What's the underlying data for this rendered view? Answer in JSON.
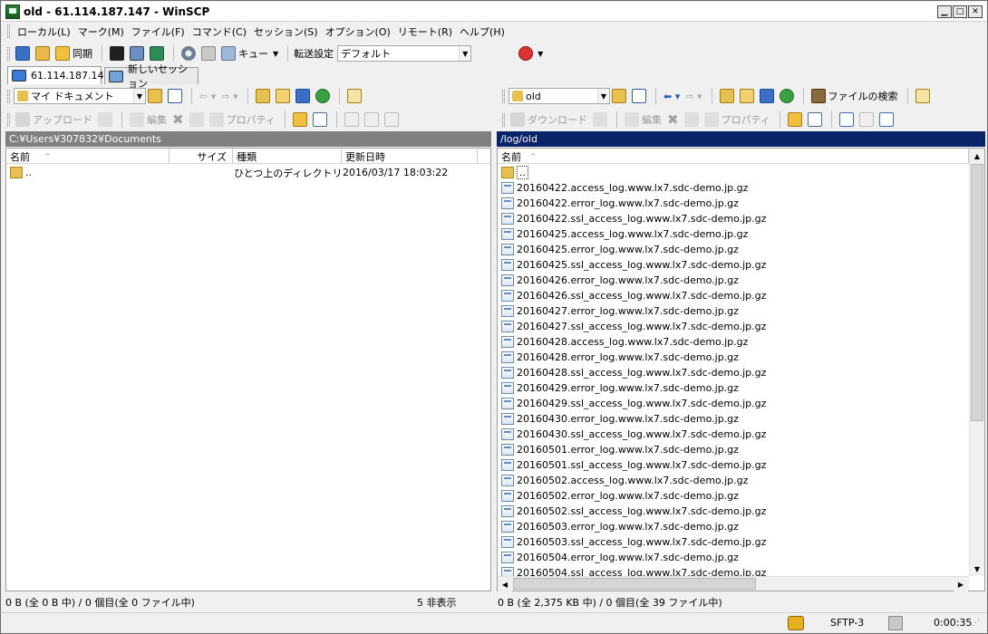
{
  "window": {
    "title": "old - 61.114.187.147 - WinSCP",
    "min": "▁",
    "max": "□",
    "close": "✕"
  },
  "menu": [
    "ローカル(L)",
    "マーク(M)",
    "ファイル(F)",
    "コマンド(C)",
    "セッション(S)",
    "オプション(O)",
    "リモート(R)",
    "ヘルプ(H)"
  ],
  "toolbar": {
    "sync_label": "同期",
    "queue_label": "キュー",
    "transfer_label": "転送設定",
    "transfer_value": "デフォルト"
  },
  "tabs": {
    "session": "61.114.187.147",
    "new_session": "新しいセッション"
  },
  "local": {
    "location": "マイ ドキュメント",
    "upload": "アップロード",
    "edit": "編集",
    "properties": "プロパティ",
    "path": "C:¥Users¥307832¥Documents",
    "columns": {
      "name": "名前",
      "size": "サイズ",
      "type": "種類",
      "modified": "更新日時"
    },
    "rows": [
      {
        "name": "..",
        "type": "ひとつ上のディレクトリ",
        "modified": "2016/03/17   18:03:22"
      }
    ]
  },
  "remote": {
    "location": "old",
    "download": "ダウンロード",
    "edit": "編集",
    "properties": "プロパティ",
    "find_files": "ファイルの検索",
    "path": "/log/old",
    "columns": {
      "name": "名前"
    },
    "parent": "..",
    "files": [
      "20160422.access_log.www.lx7.sdc-demo.jp.gz",
      "20160422.error_log.www.lx7.sdc-demo.jp.gz",
      "20160422.ssl_access_log.www.lx7.sdc-demo.jp.gz",
      "20160425.access_log.www.lx7.sdc-demo.jp.gz",
      "20160425.error_log.www.lx7.sdc-demo.jp.gz",
      "20160425.ssl_access_log.www.lx7.sdc-demo.jp.gz",
      "20160426.error_log.www.lx7.sdc-demo.jp.gz",
      "20160426.ssl_access_log.www.lx7.sdc-demo.jp.gz",
      "20160427.error_log.www.lx7.sdc-demo.jp.gz",
      "20160427.ssl_access_log.www.lx7.sdc-demo.jp.gz",
      "20160428.access_log.www.lx7.sdc-demo.jp.gz",
      "20160428.error_log.www.lx7.sdc-demo.jp.gz",
      "20160428.ssl_access_log.www.lx7.sdc-demo.jp.gz",
      "20160429.error_log.www.lx7.sdc-demo.jp.gz",
      "20160429.ssl_access_log.www.lx7.sdc-demo.jp.gz",
      "20160430.error_log.www.lx7.sdc-demo.jp.gz",
      "20160430.ssl_access_log.www.lx7.sdc-demo.jp.gz",
      "20160501.error_log.www.lx7.sdc-demo.jp.gz",
      "20160501.ssl_access_log.www.lx7.sdc-demo.jp.gz",
      "20160502.access_log.www.lx7.sdc-demo.jp.gz",
      "20160502.error_log.www.lx7.sdc-demo.jp.gz",
      "20160502.ssl_access_log.www.lx7.sdc-demo.jp.gz",
      "20160503.error_log.www.lx7.sdc-demo.jp.gz",
      "20160503.ssl_access_log.www.lx7.sdc-demo.jp.gz",
      "20160504.error_log.www.lx7.sdc-demo.jp.gz",
      "20160504.ssl_access_log.www.lx7.sdc-demo.jp.gz"
    ]
  },
  "status": {
    "local": "0 B (全 0 B 中) / 0 個目(全 0 ファイル中)",
    "hidden": "5 非表示",
    "remote": "0 B (全 2,375 KB 中) / 0 個目(全 39 ファイル中)",
    "protocol": "SFTP-3",
    "elapsed": "0:00:35"
  },
  "colors": {
    "path_active": "#0a246a",
    "path_inactive": "#808080"
  }
}
